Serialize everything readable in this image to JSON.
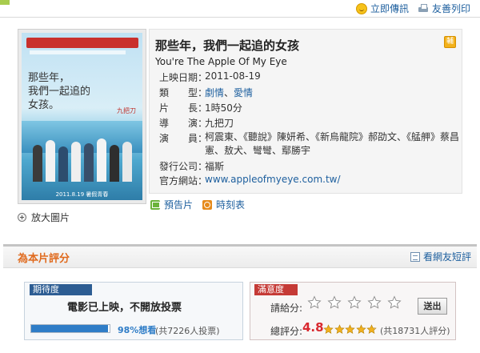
{
  "topbar": {
    "share_label": "立即傳訊",
    "print_label": "友善列印"
  },
  "movie": {
    "title_cn": "那些年，我們一起追的女孩",
    "title_en": "You're The Apple Of My Eye",
    "rating_badge": "輔",
    "release_label": "上映日期：",
    "release_date": "2011-08-19",
    "genre_label": "類　　型：",
    "genres": [
      "劇情",
      "愛情"
    ],
    "genre_sep": "、",
    "length_label": "片　　長：",
    "length": "1時50分",
    "director_label": "導　　演：",
    "director": "九把刀",
    "cast_label": "演　　員：",
    "cast": "柯震東、《聽說》陳妍希、《新烏龍院》郝劭文、《艋舺》蔡昌憲、敖犬、彎彎、鄢勝宇",
    "distributor_label": "發行公司：",
    "distributor": "福斯",
    "website_label": "官方網站：",
    "website": "www.appleofmyeye.com.tw/",
    "poster": {
      "script_line1": "那些年，",
      "script_line2": "我們一起追的",
      "script_line3": "女孩。",
      "red_text": "九把刀",
      "date_text": "2011.8.19 暑假青春"
    },
    "zoom_label": "放大圖片",
    "trailer_label": "預告片",
    "showtimes_label": "時刻表"
  },
  "rating": {
    "section_title": "為本片評分",
    "reviews_link": "看網友短評",
    "expect_tag": "期待度",
    "expect_message": "電影已上映，不開放投票",
    "expect_percent": 98,
    "expect_percent_label": "98%想看",
    "expect_votes": "(共7226人投票)",
    "satisfaction_tag": "滿意度",
    "give_label": "請給分:",
    "send_label": "送出",
    "total_label": "總評分:",
    "score": "4.8",
    "score_stars": 4.8,
    "total_votes": "(共18731人評分)"
  },
  "colors": {
    "link": "#1d5f9e",
    "accent_orange": "#e06a1d",
    "expect_tag": "#2d5d93",
    "satisfaction_tag": "#c53a36",
    "score": "#d8282f",
    "star_gold": "#f2b01e"
  }
}
